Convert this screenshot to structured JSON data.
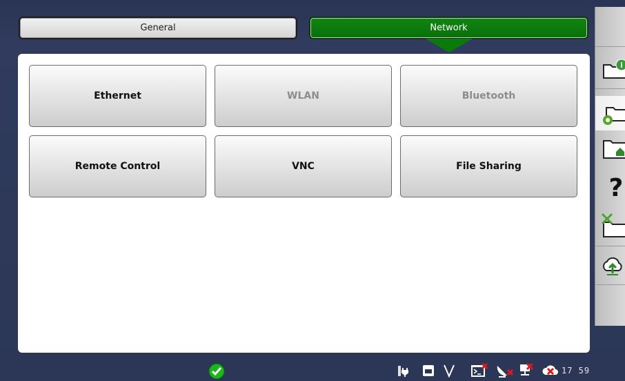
{
  "tabs": {
    "general_label": "General",
    "network_label": "Network",
    "active": "Network"
  },
  "buttons": [
    {
      "label": "Ethernet",
      "enabled": true
    },
    {
      "label": "WLAN",
      "enabled": false
    },
    {
      "label": "Bluetooth",
      "enabled": false
    },
    {
      "label": "Remote Control",
      "enabled": true
    },
    {
      "label": "VNC",
      "enabled": true
    },
    {
      "label": "File Sharing",
      "enabled": true
    }
  ],
  "sidebar": {
    "items": [
      {
        "icon": "folder-info-icon"
      },
      {
        "icon": "folder-settings-icon",
        "selected": true
      },
      {
        "icon": "folder-home-icon"
      },
      {
        "icon": "help-icon"
      },
      {
        "icon": "folder-tools-icon"
      },
      {
        "icon": "cloud-upload-icon"
      }
    ]
  },
  "status_bar": {
    "time": "17 59",
    "icons": [
      "ok-check-icon",
      "power-plug-icon",
      "storage-icon",
      "v-icon",
      "terminal-icon",
      "satellite-dish-icon",
      "network-disconnected-icon",
      "cloud-error-icon"
    ]
  },
  "colors": {
    "background": "#2b3655",
    "active_tab": "#0a7a0a",
    "panel": "#ffffff",
    "ok": "#1fb51f",
    "error": "#d61b1b"
  }
}
